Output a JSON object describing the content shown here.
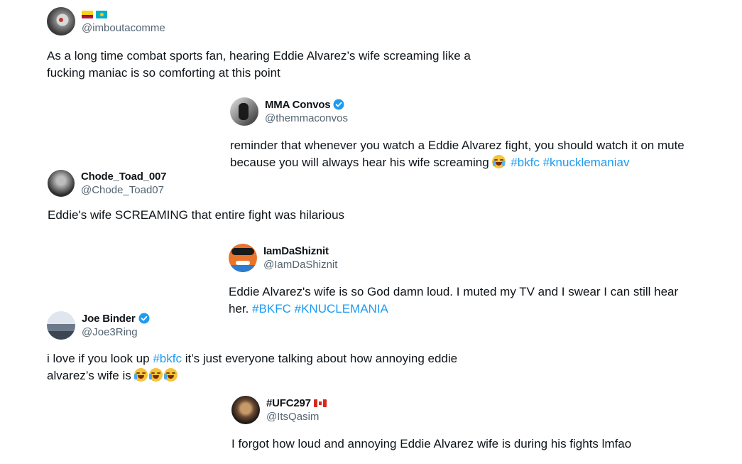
{
  "tweets": [
    {
      "name": "",
      "handle": "@imboutacomme",
      "flags": [
        "colombia-flag",
        "kazakhstan-flag"
      ],
      "text": "As a long time combat sports fan, hearing Eddie Alvarez’s wife screaming like a fucking maniac is so comforting at this point"
    },
    {
      "name": "MMA Convos",
      "handle": "@themmaconvos",
      "verified": true,
      "text": "reminder that whenever you watch a Eddie Alvarez fight, you should watch it on mute because you will always hear his wife screaming",
      "emoji": "loudly-crying-face-emoji",
      "hashtags": [
        "#bkfc",
        "#knucklemaniav"
      ]
    },
    {
      "name": "Chode_Toad_007",
      "handle": "@Chode_Toad07",
      "text": "Eddie's wife SCREAMING that entire fight was hilarious"
    },
    {
      "name": "IamDaShiznit",
      "handle": "@IamDaShiznit",
      "text": "Eddie Alvarez's wife is so God damn loud. I muted my TV and I swear I can still hear her.",
      "hashtags": [
        "#BKFC",
        "#KNUCLEMANIA"
      ]
    },
    {
      "name": "Joe Binder",
      "handle": "@Joe3Ring",
      "verified": true,
      "text_before": "i love if you look up",
      "hashtag": "#bkfc",
      "text_after": "it’s just everyone talking about how annoying eddie alvarez’s wife is",
      "emoji": "tears-of-joy-emoji"
    },
    {
      "name": "#UFC297",
      "handle": "@ItsQasim",
      "flags": [
        "canada-flag"
      ],
      "text": "I forgot how loud and annoying Eddie Alvarez wife is during his fights lmfao"
    }
  ],
  "colors": {
    "link": "#1d9bf0",
    "handle": "#536471",
    "text": "#0f1419",
    "verified": "#1d9bf0"
  }
}
